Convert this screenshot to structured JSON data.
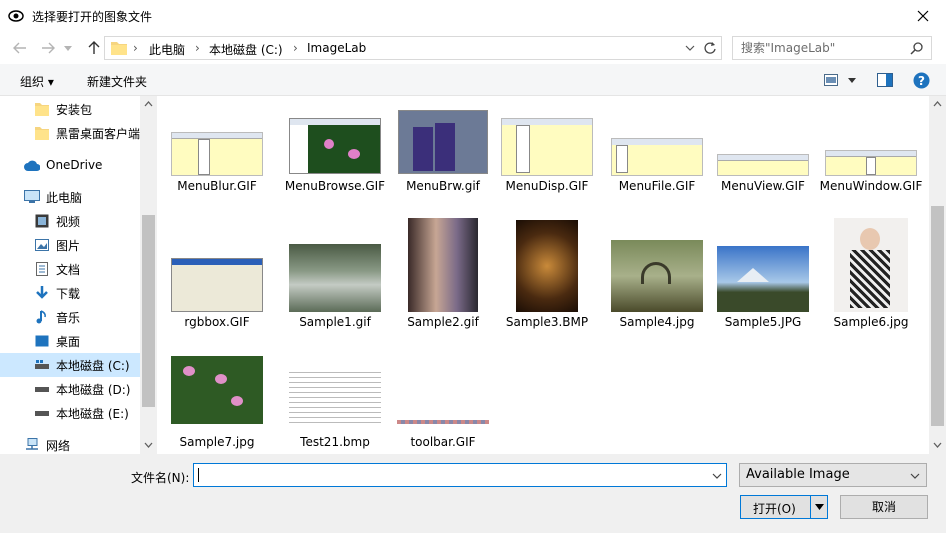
{
  "window": {
    "title": "选择要打开的图象文件"
  },
  "address": {
    "crumbs": [
      "此电脑",
      "本地磁盘 (C:)",
      "ImageLab"
    ]
  },
  "search": {
    "placeholder": "搜索\"ImageLab\""
  },
  "toolbar": {
    "organize": "组织 ▾",
    "new_folder": "新建文件夹"
  },
  "sidebar": {
    "items": [
      {
        "label": "安装包",
        "icon": "folder-icon"
      },
      {
        "label": "黑雷桌面客户端",
        "icon": "folder-icon"
      },
      {
        "label": "OneDrive",
        "icon": "cloud-icon"
      },
      {
        "label": "此电脑",
        "icon": "computer-icon"
      },
      {
        "label": "视频",
        "icon": "video-icon"
      },
      {
        "label": "图片",
        "icon": "picture-icon"
      },
      {
        "label": "文档",
        "icon": "document-icon"
      },
      {
        "label": "下载",
        "icon": "download-icon"
      },
      {
        "label": "音乐",
        "icon": "music-icon"
      },
      {
        "label": "桌面",
        "icon": "desktop-icon"
      },
      {
        "label": "本地磁盘 (C:)",
        "icon": "drive-icon",
        "selected": true
      },
      {
        "label": "本地磁盘 (D:)",
        "icon": "drive-icon"
      },
      {
        "label": "本地磁盘 (E:)",
        "icon": "drive-icon"
      },
      {
        "label": "网络",
        "icon": "network-icon"
      }
    ]
  },
  "files": [
    {
      "name": "MenuBlur.GIF",
      "kind": "menu"
    },
    {
      "name": "MenuBrowse.GIF",
      "kind": "lotus"
    },
    {
      "name": "MenuBrw.gif",
      "kind": "people"
    },
    {
      "name": "MenuDisp.GIF",
      "kind": "menu"
    },
    {
      "name": "MenuFile.GIF",
      "kind": "menu"
    },
    {
      "name": "MenuView.GIF",
      "kind": "menubar"
    },
    {
      "name": "MenuWindow.GIF",
      "kind": "menubar"
    },
    {
      "name": "rgbbox.GIF",
      "kind": "dialog"
    },
    {
      "name": "Sample1.gif",
      "kind": "rocks"
    },
    {
      "name": "Sample2.gif",
      "kind": "portrait"
    },
    {
      "name": "Sample3.BMP",
      "kind": "dark-portrait"
    },
    {
      "name": "Sample4.jpg",
      "kind": "bridge"
    },
    {
      "name": "Sample5.JPG",
      "kind": "mountain"
    },
    {
      "name": "Sample6.jpg",
      "kind": "woman"
    },
    {
      "name": "Sample7.jpg",
      "kind": "flowers"
    },
    {
      "name": "Test21.bmp",
      "kind": "text-doc"
    },
    {
      "name": "toolbar.GIF",
      "kind": "strip"
    }
  ],
  "footer": {
    "filename_label": "文件名(N):",
    "filename_value": "",
    "filter": "Available Image",
    "open": "打开(O)",
    "cancel": "取消"
  }
}
